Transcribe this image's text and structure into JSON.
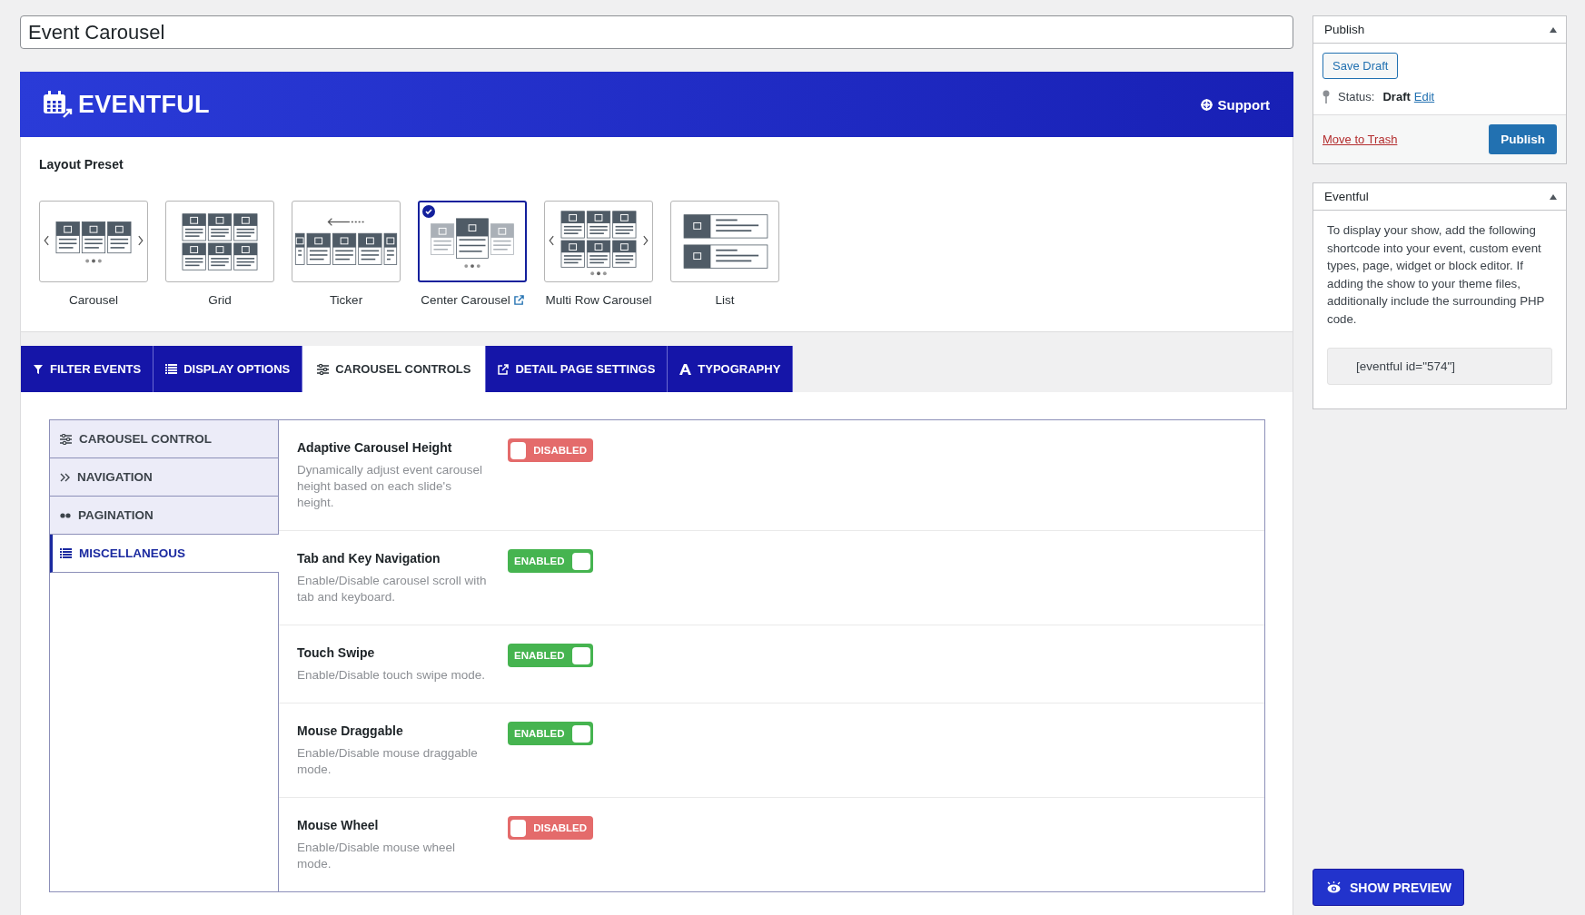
{
  "post_title": {
    "value": "Event Carousel"
  },
  "banner": {
    "logo": "EVENTFUL",
    "support": "Support"
  },
  "layout_preset": {
    "label": "Layout Preset",
    "presets": [
      {
        "label": "Carousel",
        "kind": "carousel",
        "selected": false,
        "link_icon": false
      },
      {
        "label": "Grid",
        "kind": "grid",
        "selected": false,
        "link_icon": false
      },
      {
        "label": "Ticker",
        "kind": "ticker",
        "selected": false,
        "link_icon": false
      },
      {
        "label": "Center Carousel",
        "kind": "center",
        "selected": true,
        "link_icon": true
      },
      {
        "label": "Multi Row Carousel",
        "kind": "multirow",
        "selected": false,
        "link_icon": false
      },
      {
        "label": "List",
        "kind": "list",
        "selected": false,
        "link_icon": false
      }
    ]
  },
  "tabs": [
    {
      "label": "FILTER EVENTS",
      "kind": "filter",
      "selected": false
    },
    {
      "label": "DISPLAY OPTIONS",
      "kind": "list",
      "selected": false
    },
    {
      "label": "CAROUSEL CONTROLS",
      "kind": "sliders",
      "selected": true
    },
    {
      "label": "DETAIL PAGE SETTINGS",
      "kind": "external",
      "selected": false
    },
    {
      "label": "TYPOGRAPHY",
      "kind": "type",
      "selected": false
    }
  ],
  "subnav": [
    {
      "label": "CAROUSEL CONTROL",
      "kind": "sliders",
      "selected": false
    },
    {
      "label": "NAVIGATION",
      "kind": "chevrons",
      "selected": false
    },
    {
      "label": "PAGINATION",
      "kind": "dots",
      "selected": false
    },
    {
      "label": "MISCELLANEOUS",
      "kind": "list",
      "selected": true
    }
  ],
  "settings": [
    {
      "title": "Adaptive Carousel Height",
      "description": "Dynamically adjust event carousel height based on each slide's height.",
      "enabled": false,
      "toggle_label": "DISABLED"
    },
    {
      "title": "Tab and Key Navigation",
      "description": "Enable/Disable carousel scroll with tab and keyboard.",
      "enabled": true,
      "toggle_label": "ENABLED"
    },
    {
      "title": "Touch Swipe",
      "description": "Enable/Disable touch swipe mode.",
      "enabled": true,
      "toggle_label": "ENABLED"
    },
    {
      "title": "Mouse Draggable",
      "description": "Enable/Disable mouse draggable mode.",
      "enabled": true,
      "toggle_label": "ENABLED"
    },
    {
      "title": "Mouse Wheel",
      "description": "Enable/Disable mouse wheel mode.",
      "enabled": false,
      "toggle_label": "DISABLED"
    }
  ],
  "sidebar": {
    "publish": {
      "title": "Publish",
      "save_draft": "Save Draft",
      "status_label": "Status:",
      "status_value": "Draft",
      "edit": "Edit",
      "trash": "Move to Trash",
      "publish": "Publish"
    },
    "eventful_box": {
      "title": "Eventful",
      "text": "To display your show, add the following shortcode into your event, custom event types, page, widget or block editor. If adding the show to your theme files, additionally include the surrounding PHP code.",
      "shortcode": "[eventful id=\"574\"]"
    }
  },
  "preview_button": {
    "label": "SHOW PREVIEW"
  }
}
